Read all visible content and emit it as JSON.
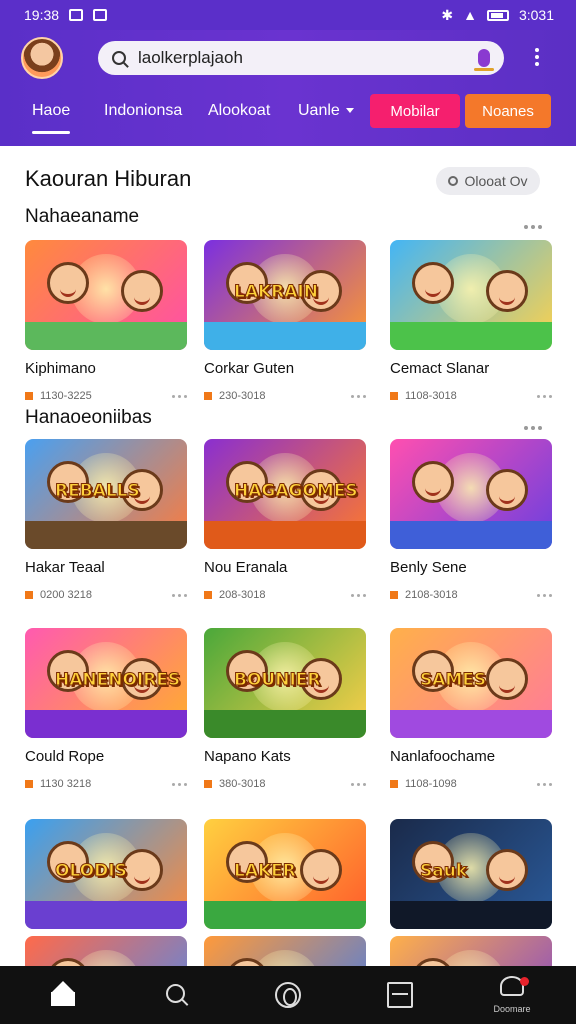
{
  "status": {
    "time": "19:38",
    "right_text": "3:031"
  },
  "search": {
    "value": "laolkerplajaoh"
  },
  "nav": {
    "tabs": [
      {
        "label": "Haoe",
        "active": true
      },
      {
        "label": "Indonionsa"
      },
      {
        "label": "Alookoat"
      },
      {
        "label": "Uanle",
        "dropdown": true
      }
    ],
    "pills": [
      {
        "label": "Mobilar",
        "color": "#f51f6e"
      },
      {
        "label": "Noanes",
        "color": "#f4782a"
      }
    ]
  },
  "page": {
    "title": "Kaouran Hiburan",
    "chip": "Olooat Ov"
  },
  "sections": [
    {
      "title": "Nahaeaname"
    },
    {
      "title": "Hanaoeoniibas"
    }
  ],
  "cards": [
    {
      "title": "Kiphimano",
      "meta": "1130-3225",
      "colors": [
        "#ff8a3d",
        "#ff4fa8"
      ],
      "ground": "#5cb85c"
    },
    {
      "title": "Corkar Guten",
      "meta": "230-3018",
      "colors": [
        "#7b2fe0",
        "#ff9a2e"
      ],
      "ground": "#3fb0e8",
      "logo": "LAKRAIN"
    },
    {
      "title": "Cemact Slanar",
      "meta": "1108-3018",
      "colors": [
        "#43b5f5",
        "#ffd24a"
      ],
      "ground": "#4cc24a"
    },
    {
      "title": "Hakar Teaal",
      "meta": "0200 3218",
      "colors": [
        "#4aa0f0",
        "#ff7b3a"
      ],
      "ground": "#6a4a2a",
      "logo": "REBALLS"
    },
    {
      "title": "Nou Eranala",
      "meta": "208-3018",
      "colors": [
        "#8a2fd0",
        "#ff7a2a"
      ],
      "ground": "#e05a1a",
      "logo": "HAGAGOMES"
    },
    {
      "title": "Benly Sene",
      "meta": "2108-3018",
      "colors": [
        "#ff4fb0",
        "#6a3fe0"
      ],
      "ground": "#3f5fd8"
    },
    {
      "title": "Could Rope",
      "meta": "1130 3218",
      "colors": [
        "#ff5ab0",
        "#ffb02a"
      ],
      "ground": "#7a2fd0",
      "logo": "HANENOIRES"
    },
    {
      "title": "Napano Kats",
      "meta": "380-3018",
      "colors": [
        "#4aa83a",
        "#ffd04a"
      ],
      "ground": "#3a8a2a",
      "logo": "BOUNIER"
    },
    {
      "title": "Nanlafoochame",
      "meta": "1108-1098",
      "colors": [
        "#ffb04a",
        "#ff7a9a"
      ],
      "ground": "#a04ae0",
      "logo": "SAMES"
    },
    {
      "title": "",
      "meta": "",
      "colors": [
        "#3aa0f0",
        "#ff8a3a"
      ],
      "ground": "#6a3fd0",
      "logo": "OLODIS"
    },
    {
      "title": "",
      "meta": "",
      "colors": [
        "#ffd040",
        "#ff5a2a"
      ],
      "ground": "#3aa840",
      "logo": "LAKER"
    },
    {
      "title": "",
      "meta": "",
      "colors": [
        "#1a2a4a",
        "#2a5a9a"
      ],
      "ground": "#101828",
      "logo": "Sauk"
    },
    {
      "title": "",
      "meta": "",
      "colors": [
        "#ff6a4a",
        "#4a8af0"
      ],
      "ground": "#ffb04a"
    },
    {
      "title": "",
      "meta": "",
      "colors": [
        "#ff9a3a",
        "#3a7af0"
      ],
      "ground": "#ff6a4a"
    },
    {
      "title": "",
      "meta": "",
      "colors": [
        "#ffb04a",
        "#7a3fd0"
      ],
      "ground": "#3a6ad0"
    }
  ],
  "bottom_nav": {
    "profile_label": "Doomare"
  }
}
